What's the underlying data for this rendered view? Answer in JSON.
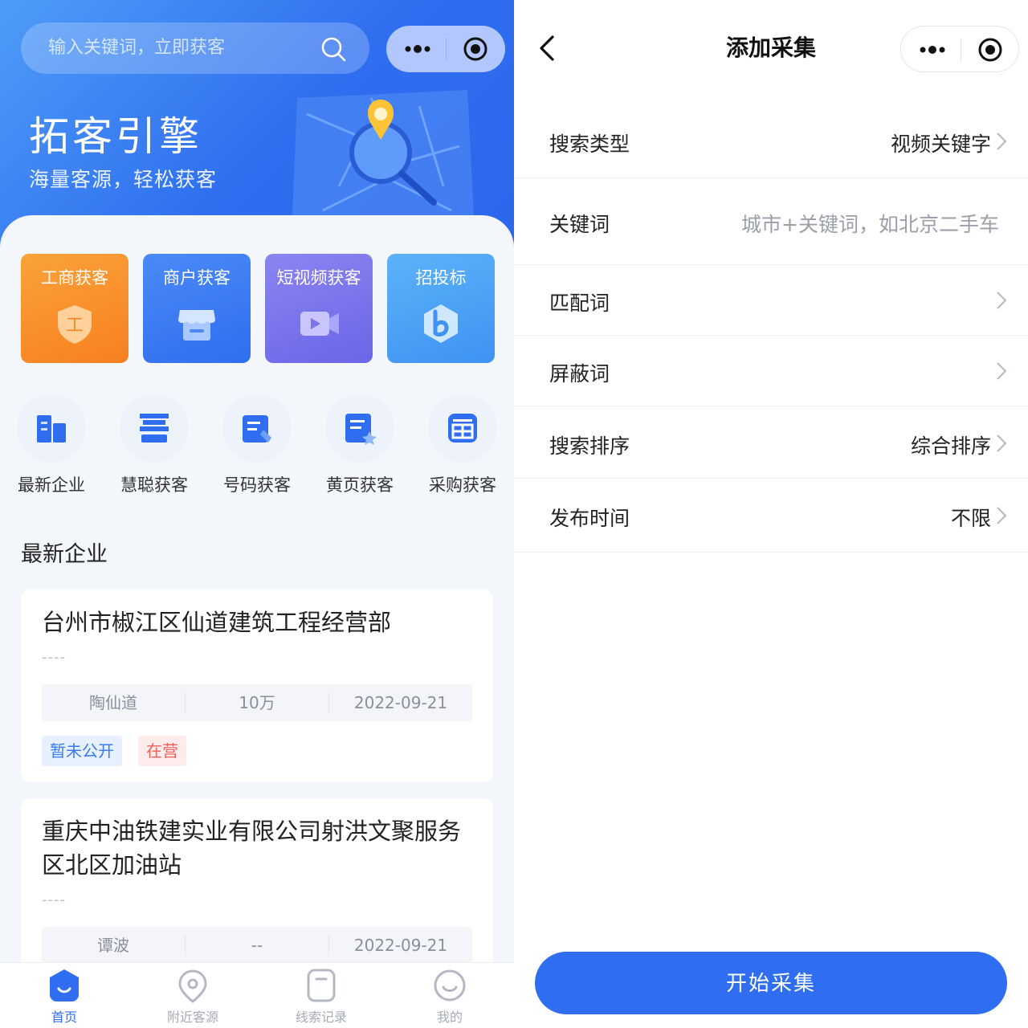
{
  "left": {
    "search": {
      "placeholder": "输入关键词，立即获客"
    },
    "hero": {
      "title": "拓客引擎",
      "subtitle": "海量客源，轻松获客"
    },
    "big_tiles": [
      {
        "label": "工商获客",
        "icon": "shield-icon",
        "color": "#f7902b"
      },
      {
        "label": "商户获客",
        "icon": "store-icon",
        "color": "#3d7df2"
      },
      {
        "label": "短视频获客",
        "icon": "video-icon",
        "color": "#7d76ec"
      },
      {
        "label": "招投标",
        "icon": "bid-logo-icon",
        "color": "#5ab0f7"
      }
    ],
    "small_items": [
      {
        "label": "最新企业",
        "icon": "building-icon"
      },
      {
        "label": "慧聪获客",
        "icon": "hui-icon"
      },
      {
        "label": "号码获客",
        "icon": "phone-book-icon"
      },
      {
        "label": "黄页获客",
        "icon": "yellow-page-icon"
      },
      {
        "label": "采购获客",
        "icon": "purchase-icon"
      }
    ],
    "section_title": "最新企业",
    "companies": [
      {
        "name": "台州市椒江区仙道建筑工程经营部",
        "dash": "----",
        "person": "陶仙道",
        "capital": "10万",
        "date": "2022-09-21",
        "tags": [
          "暂未公开",
          "在营"
        ]
      },
      {
        "name": "重庆中油铁建实业有限公司射洪文聚服务区北区加油站",
        "dash": "----",
        "person": "谭波",
        "capital": "--",
        "date": "2022-09-21"
      }
    ],
    "tabbar": [
      {
        "label": "首页",
        "icon": "home-icon",
        "active": true
      },
      {
        "label": "附近客源",
        "icon": "location-icon",
        "active": false
      },
      {
        "label": "线索记录",
        "icon": "record-icon",
        "active": false
      },
      {
        "label": "我的",
        "icon": "profile-icon",
        "active": false
      }
    ]
  },
  "right": {
    "title": "添加采集",
    "rows": [
      {
        "label": "搜索类型",
        "value": "视频关键字"
      },
      {
        "label": "关键词",
        "placeholder": "城市+关键词，如北京二手车"
      },
      {
        "label": "匹配词",
        "value": ""
      },
      {
        "label": "屏蔽词",
        "value": ""
      },
      {
        "label": "搜索排序",
        "value": "综合排序"
      },
      {
        "label": "发布时间",
        "value": "不限"
      }
    ],
    "button": "开始采集"
  },
  "colors": {
    "primary": "#2f6ef0",
    "orange": "#f7902b",
    "red_tag": "#f0605a"
  }
}
